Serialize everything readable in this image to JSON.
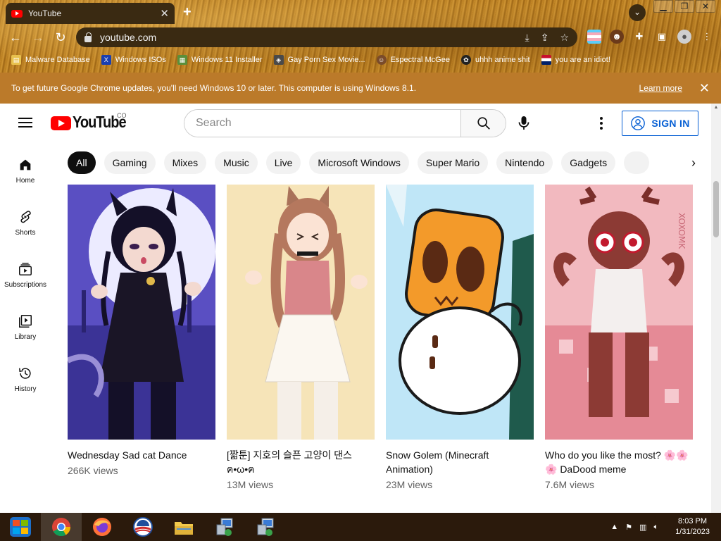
{
  "browser": {
    "tab_title": "YouTube",
    "tab_close": "✕",
    "new_tab": "+",
    "url": "youtube.com",
    "win_minimize": "▁",
    "win_restore": "❐",
    "win_close": "✕",
    "bookmarks": [
      {
        "label": "Malware Database",
        "icon": "folder-icon"
      },
      {
        "label": "Windows ISOs",
        "icon": "x-logo-icon"
      },
      {
        "label": "Windows 11 Installer",
        "icon": "image-icon"
      },
      {
        "label": "Gay Porn Sex Movie...",
        "icon": "site-icon"
      },
      {
        "label": "Espectral McGee",
        "icon": "avatar-icon"
      },
      {
        "label": "uhhh anime shit",
        "icon": "anime-icon"
      },
      {
        "label": "you are an idiot!",
        "icon": "flag-icon"
      }
    ]
  },
  "infobar": {
    "message": "To get future Google Chrome updates, you'll need Windows 10 or later. This computer is using Windows 8.1.",
    "link": "Learn more",
    "close": "✕"
  },
  "youtube": {
    "logo_text": "YouTube",
    "country_code": "CO",
    "search_placeholder": "Search",
    "sign_in": "SIGN IN",
    "sidebar": [
      {
        "label": "Home",
        "icon": "home-icon"
      },
      {
        "label": "Shorts",
        "icon": "shorts-icon"
      },
      {
        "label": "Subscriptions",
        "icon": "subscriptions-icon"
      },
      {
        "label": "Library",
        "icon": "library-icon"
      },
      {
        "label": "History",
        "icon": "history-icon"
      }
    ],
    "chips": [
      "All",
      "Gaming",
      "Mixes",
      "Music",
      "Live",
      "Microsoft Windows",
      "Super Mario",
      "Nintendo",
      "Gadgets"
    ],
    "active_chip": "All",
    "videos": [
      {
        "title": "Wednesday Sad cat Dance",
        "views": "266K views"
      },
      {
        "title": "[짧툰] 지호의 슬픈 고양이 댄스 ฅ•ω•ฅ",
        "views": "13M views"
      },
      {
        "title": "Snow Golem (Minecraft Animation)",
        "views": "23M views"
      },
      {
        "title": "Who do you like the most? 🌸🌸🌸 DaDood meme",
        "views": "7.6M views"
      }
    ]
  },
  "taskbar": {
    "items": [
      "start-button",
      "chrome-icon",
      "firefox-icon",
      "obama-icon",
      "file-explorer-icon",
      "network-setup-icon",
      "network-setup-icon"
    ],
    "time": "8:03 PM",
    "date": "1/31/2023"
  },
  "colors": {
    "youtube_red": "#ff0000",
    "signin_blue": "#065fd4",
    "infobar_orange": "#bb7a2a",
    "taskbar": "#2b1a0c"
  }
}
